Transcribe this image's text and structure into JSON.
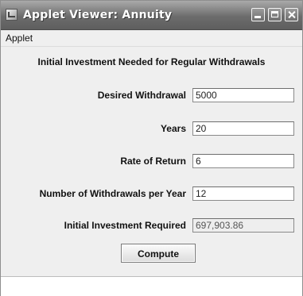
{
  "window": {
    "title": "Applet Viewer: Annuity"
  },
  "menu": {
    "items": [
      {
        "label": "Applet"
      }
    ]
  },
  "applet": {
    "heading": "Initial Investment Needed for Regular Withdrawals",
    "fields": [
      {
        "label": "Desired Withdrawal",
        "value": "5000"
      },
      {
        "label": "Years",
        "value": "20"
      },
      {
        "label": "Rate of Return",
        "value": "6"
      },
      {
        "label": "Number of Withdrawals per Year",
        "value": "12"
      },
      {
        "label": "Initial Investment Required",
        "value": "697,903.86",
        "readonly": true
      }
    ],
    "compute_label": "Compute"
  }
}
